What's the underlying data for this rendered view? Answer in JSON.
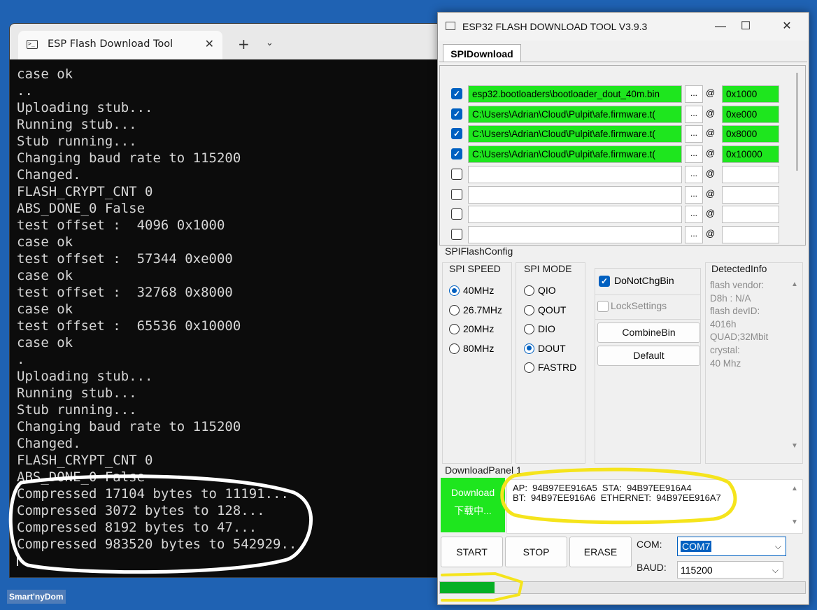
{
  "terminal": {
    "tab_title": "ESP Flash Download Tool",
    "tab_icon": "terminal-icon",
    "close_glyph": "✕",
    "new_tab_glyph": "+",
    "dropdown_glyph": "⌄",
    "lines": [
      "case ok",
      "..",
      "Uploading stub...",
      "Running stub...",
      "Stub running...",
      "Changing baud rate to 115200",
      "Changed.",
      "FLASH_CRYPT_CNT 0",
      "ABS_DONE_0 False",
      "test offset :  4096 0x1000",
      "case ok",
      "test offset :  57344 0xe000",
      "case ok",
      "test offset :  32768 0x8000",
      "case ok",
      "test offset :  65536 0x10000",
      "case ok",
      ".",
      "Uploading stub...",
      "Running stub...",
      "Stub running...",
      "Changing baud rate to 115200",
      "Changed.",
      "FLASH_CRYPT_CNT 0",
      "ABS_DONE_0 False",
      "Compressed 17104 bytes to 11191...",
      "Compressed 3072 bytes to 128...",
      "Compressed 8192 bytes to 47...",
      "Compressed 983520 bytes to 542929..."
    ]
  },
  "esp_tool": {
    "title": "ESP32 FLASH DOWNLOAD TOOL V3.9.3",
    "window_buttons": {
      "minimize": "—",
      "maximize": "☐",
      "close": "✕"
    },
    "tab": "SPIDownload",
    "files": [
      {
        "checked": true,
        "path": "esp32.bootloaders\\bootloader_dout_40m.bin",
        "browse": "...",
        "at": "@",
        "address": "0x1000",
        "highlight": true
      },
      {
        "checked": true,
        "path": "C:\\Users\\Adrian\\Cloud\\Pulpit\\afe.firmware.t(",
        "browse": "...",
        "at": "@",
        "address": "0xe000",
        "highlight": true
      },
      {
        "checked": true,
        "path": "C:\\Users\\Adrian\\Cloud\\Pulpit\\afe.firmware.t(",
        "browse": "...",
        "at": "@",
        "address": "0x8000",
        "highlight": true
      },
      {
        "checked": true,
        "path": "C:\\Users\\Adrian\\Cloud\\Pulpit\\afe.firmware.t(",
        "browse": "...",
        "at": "@",
        "address": "0x10000",
        "highlight": true
      },
      {
        "checked": false,
        "path": "",
        "browse": "...",
        "at": "@",
        "address": "",
        "highlight": false
      },
      {
        "checked": false,
        "path": "",
        "browse": "...",
        "at": "@",
        "address": "",
        "highlight": false
      },
      {
        "checked": false,
        "path": "",
        "browse": "...",
        "at": "@",
        "address": "",
        "highlight": false
      },
      {
        "checked": false,
        "path": "",
        "browse": "...",
        "at": "@",
        "address": "",
        "highlight": false
      }
    ],
    "spi_flash_config": {
      "label": "SPIFlashConfig",
      "spi_speed": {
        "label": "SPI SPEED",
        "options": [
          "40MHz",
          "26.7MHz",
          "20MHz",
          "80MHz"
        ],
        "selected": "40MHz"
      },
      "spi_mode": {
        "label": "SPI MODE",
        "options": [
          "QIO",
          "QOUT",
          "DIO",
          "DOUT",
          "FASTRD"
        ],
        "selected": "DOUT"
      },
      "do_not_chg_bin": {
        "label": "DoNotChgBin",
        "checked": true
      },
      "lock_settings": {
        "label": "LockSettings",
        "checked": false
      },
      "combine_bin_label": "CombineBin",
      "default_label": "Default",
      "detected_info": {
        "label": "DetectedInfo",
        "text": "flash vendor:\nD8h : N/A\nflash devID:\n4016h\nQUAD;32Mbit\ncrystal:\n40 Mhz"
      }
    },
    "download_panel": {
      "label": "DownloadPanel 1",
      "status_line1": "Download",
      "status_line2": "下载中...",
      "log": "AP:  94B97EE916A5  STA:  94B97EE916A4\nBT:  94B97EE916A6  ETHERNET:  94B97EE916A7",
      "start_label": "START",
      "stop_label": "STOP",
      "erase_label": "ERASE",
      "com_label": "COM:",
      "com_value": "COM7",
      "baud_label": "BAUD:",
      "baud_value": "115200",
      "progress": 0.15
    },
    "colors": {
      "green_highlight": "#1ee61e",
      "accent": "#0060c0",
      "progress": "#06b025",
      "annotation_yellow": "#f5e41c"
    }
  },
  "watermark": "Smart'nyDom"
}
